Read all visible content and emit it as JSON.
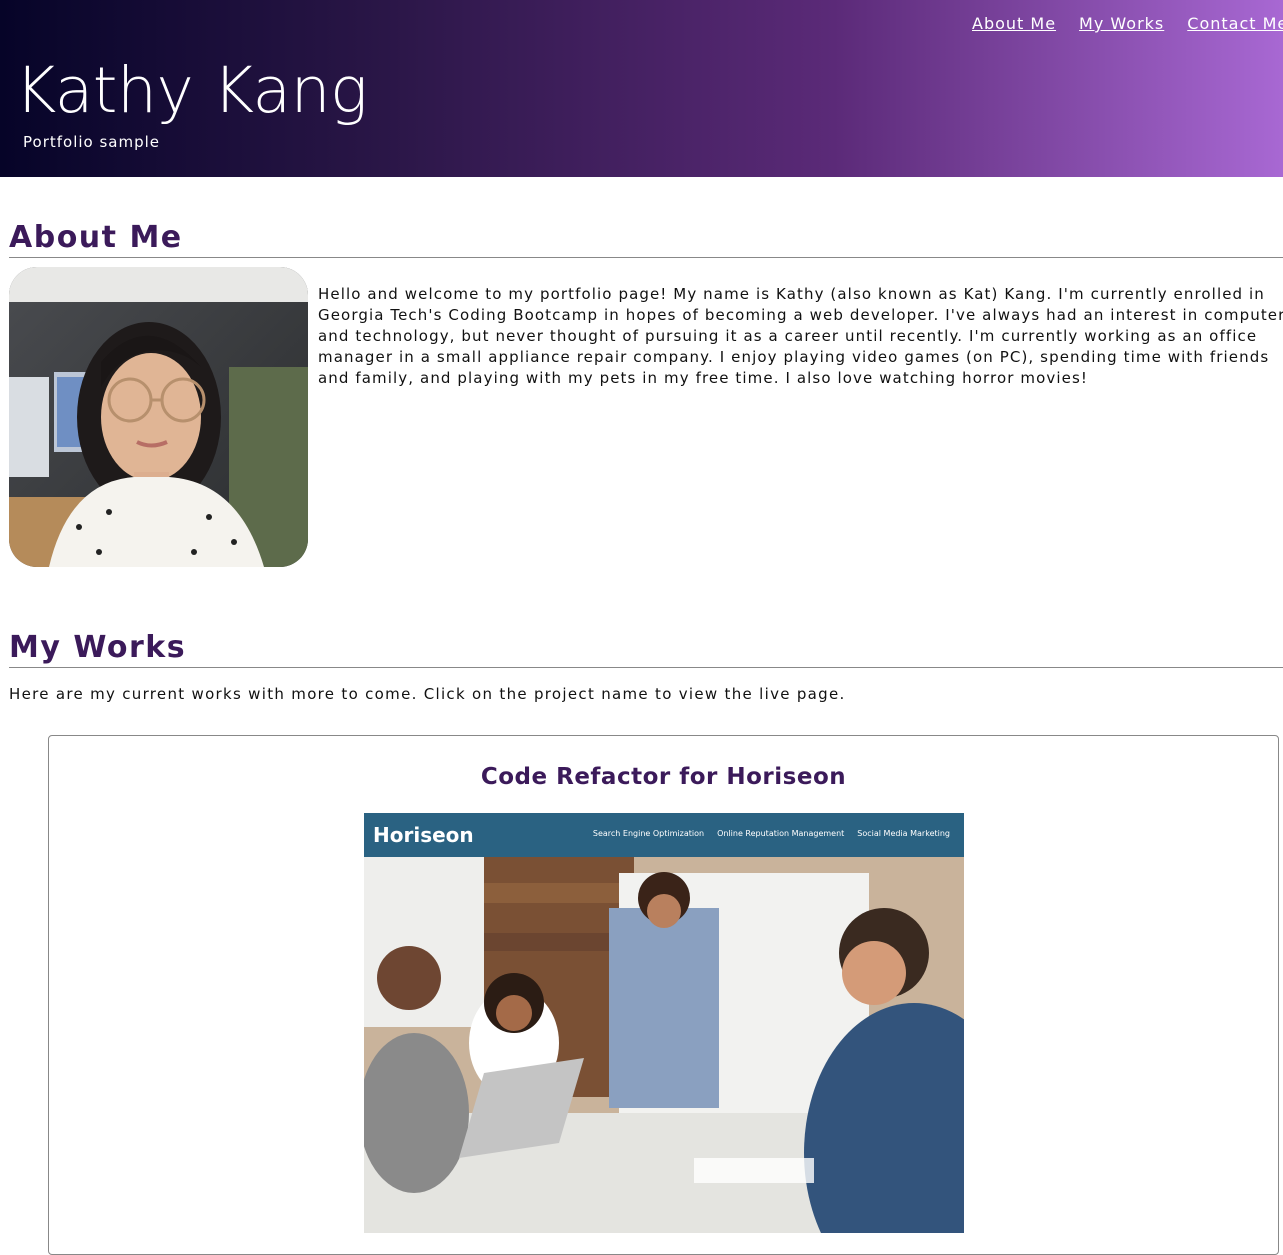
{
  "header": {
    "title": "Kathy Kang",
    "subtitle": "Portfolio sample",
    "nav": [
      "About Me",
      "My Works",
      "Contact Me"
    ]
  },
  "about": {
    "heading": "About Me",
    "photo_icon": "profile-photo",
    "text": "Hello and welcome to my portfolio page! My name is Kathy (also known as Kat) Kang. I'm currently enrolled in Georgia Tech's Coding Bootcamp in hopes of becoming a web developer. I've always had an interest in computers and technology, but never thought of pursuing it as a career until recently. I'm currently working as an office manager in a small appliance repair company. I enjoy playing video games (on PC), spending time with friends and family, and playing with my pets in my free time. I also love watching horror movies!"
  },
  "works": {
    "heading": "My Works",
    "intro": "Here are my current works with more to come. Click on the project name to view the live page.",
    "projects": [
      {
        "title": "Code Refactor for Horiseon",
        "screenshot": {
          "logo": "Horiseon",
          "nav": [
            "Search Engine Optimization",
            "Online Reputation Management",
            "Social Media Marketing"
          ]
        }
      }
    ]
  },
  "colors": {
    "heading": "#3b1a5a",
    "header_gradient_start": "#060428",
    "header_gradient_end": "#a868d3",
    "horiseon_bar": "#2a6282"
  }
}
